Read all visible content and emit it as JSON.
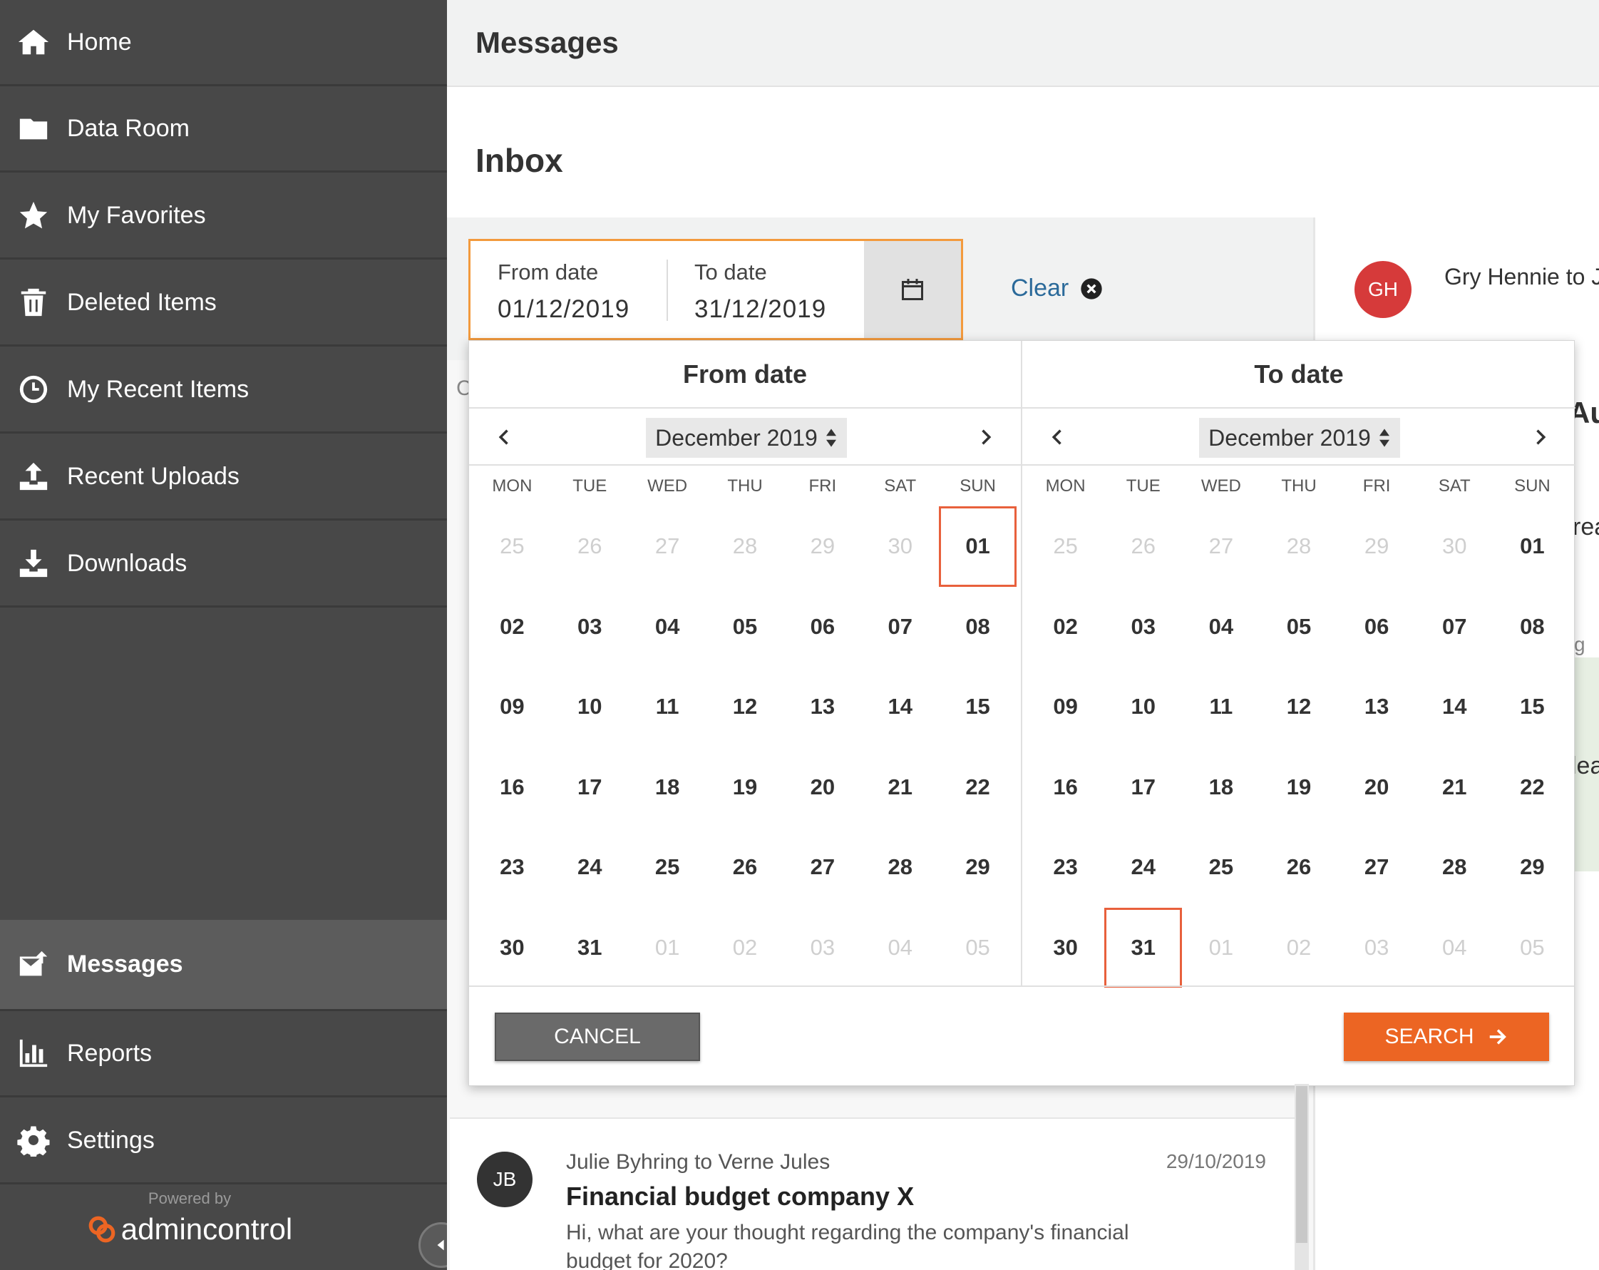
{
  "sidebar": {
    "items": [
      {
        "label": "Home",
        "icon": "home-icon"
      },
      {
        "label": "Data Room",
        "icon": "folder-icon"
      },
      {
        "label": "My Favorites",
        "icon": "star-icon"
      },
      {
        "label": "Deleted Items",
        "icon": "trash-icon"
      },
      {
        "label": "My Recent Items",
        "icon": "clock-icon"
      },
      {
        "label": "Recent Uploads",
        "icon": "upload-icon"
      },
      {
        "label": "Downloads",
        "icon": "download-icon"
      }
    ],
    "bottom_items": [
      {
        "label": "Messages",
        "icon": "envelope-icon",
        "active": true
      },
      {
        "label": "Reports",
        "icon": "bar-chart-icon"
      },
      {
        "label": "Settings",
        "icon": "gear-icon"
      }
    ],
    "powered_by": "Powered by",
    "brand": "admincontrol"
  },
  "header": {
    "title": "Messages"
  },
  "inbox": {
    "title": "Inbox"
  },
  "filter": {
    "from_label": "From date",
    "from_value": "01/12/2019",
    "to_label": "To date",
    "to_value": "31/12/2019",
    "clear_label": "Clear"
  },
  "picker": {
    "from": {
      "title": "From date",
      "month": "December 2019",
      "weekdays": [
        "MON",
        "TUE",
        "WED",
        "THU",
        "FRI",
        "SAT",
        "SUN"
      ],
      "days": [
        "25",
        "26",
        "27",
        "28",
        "29",
        "30",
        "01",
        "02",
        "03",
        "04",
        "05",
        "06",
        "07",
        "08",
        "09",
        "10",
        "11",
        "12",
        "13",
        "14",
        "15",
        "16",
        "17",
        "18",
        "19",
        "20",
        "21",
        "22",
        "23",
        "24",
        "25",
        "26",
        "27",
        "28",
        "29",
        "30",
        "31",
        "01",
        "02",
        "03",
        "04",
        "05"
      ],
      "muted": [
        0,
        1,
        2,
        3,
        4,
        5,
        37,
        38,
        39,
        40,
        41
      ],
      "selected": 6
    },
    "to": {
      "title": "To date",
      "month": "December 2019",
      "weekdays": [
        "MON",
        "TUE",
        "WED",
        "THU",
        "FRI",
        "SAT",
        "SUN"
      ],
      "days": [
        "25",
        "26",
        "27",
        "28",
        "29",
        "30",
        "01",
        "02",
        "03",
        "04",
        "05",
        "06",
        "07",
        "08",
        "09",
        "10",
        "11",
        "12",
        "13",
        "14",
        "15",
        "16",
        "17",
        "18",
        "19",
        "20",
        "21",
        "22",
        "23",
        "24",
        "25",
        "26",
        "27",
        "28",
        "29",
        "30",
        "31",
        "01",
        "02",
        "03",
        "04",
        "05"
      ],
      "muted": [
        0,
        1,
        2,
        3,
        4,
        5,
        37,
        38,
        39,
        40,
        41
      ],
      "selected": 36
    },
    "cancel_label": "CANCEL",
    "search_label": "SEARCH"
  },
  "right_panel": {
    "avatar_initials": "GH",
    "sender": "Gry Hennie to J"
  },
  "message": {
    "avatar_initials": "JB",
    "sender": "Julie Byhring to Verne Jules",
    "date": "29/10/2019",
    "subject": "Financial budget company X",
    "preview": "Hi, what are your thought regarding the company's financial budget for 2020?"
  },
  "colors": {
    "sidebar_bg": "#484848",
    "accent_orange": "#ec6523",
    "focus_border": "#f39a3d",
    "link_blue": "#2b6a9a",
    "selected_day_border": "#e8603c"
  }
}
